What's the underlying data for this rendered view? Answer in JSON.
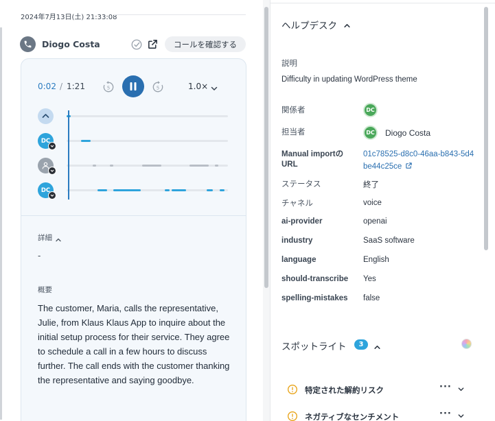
{
  "call": {
    "date": "2024年7月13日(土) 21:33:08",
    "caller_name": "Diogo Costa",
    "review_button_label": "コールを確認する"
  },
  "player": {
    "current_time": "0:02",
    "separator": "/",
    "total_time": "1:21",
    "skip_back_seconds": "5",
    "skip_forward_seconds": "5",
    "speed": "1.0×",
    "progress_fraction": 0.025,
    "tracks": [
      {
        "speaker": "DC",
        "segments": [
          [
            0.09,
            0.15
          ]
        ]
      },
      {
        "speaker": "unknown",
        "segments": [
          [
            0.16,
            0.18
          ],
          [
            0.27,
            0.29
          ],
          [
            0.47,
            0.59
          ],
          [
            0.76,
            0.88
          ],
          [
            0.92,
            0.94
          ]
        ]
      },
      {
        "speaker": "DC",
        "segments": [
          [
            0.19,
            0.25
          ],
          [
            0.29,
            0.46
          ],
          [
            0.61,
            0.64
          ],
          [
            0.65,
            0.74
          ],
          [
            0.87,
            0.91
          ],
          [
            0.95,
            0.98
          ]
        ]
      }
    ]
  },
  "details": {
    "label": "詳細",
    "value": "-"
  },
  "summary": {
    "label": "概要",
    "text": "The customer, Maria, calls the representative, Julie, from Klaus Klaus App to inquire about the initial setup process for their service. They agree to schedule a call in a few hours to discuss further. The call ends with the customer thanking the representative and saying goodbye."
  },
  "helpdesk": {
    "title": "ヘルプデスク",
    "description_label": "説明",
    "description_value": "Difficulty in updating WordPress theme",
    "participants_label": "関係者",
    "participant_initials": "DC",
    "assignee_label": "担当者",
    "assignee_initials": "DC",
    "assignee_name": "Diogo Costa",
    "manual_import_label_1": "Manual importの",
    "manual_import_label_2": "URL",
    "manual_import_value": "01c78525-d8c0-46aa-b843-5d4be44c25ce",
    "fields": [
      {
        "label": "ステータス",
        "value": "終了",
        "bold": false
      },
      {
        "label": "チャネル",
        "value": "voice",
        "bold": false
      },
      {
        "label": "ai-provider",
        "value": "openai",
        "bold": true
      },
      {
        "label": "industry",
        "value": "SaaS software",
        "bold": true
      },
      {
        "label": "language",
        "value": "English",
        "bold": true
      },
      {
        "label": "should-transcribe",
        "value": "Yes",
        "bold": true
      },
      {
        "label": "spelling-mistakes",
        "value": "false",
        "bold": true
      }
    ]
  },
  "spotlight": {
    "title": "スポットライト",
    "count": "3",
    "items": [
      {
        "label": "特定された解約リスク"
      },
      {
        "label": "ネガティブなセンチメント"
      }
    ]
  },
  "colors": {
    "accent": "#2a6fb0",
    "speaker_blue": "#2ea4dc",
    "participant_green": "#4aa85a",
    "warning": "#e8a317"
  }
}
